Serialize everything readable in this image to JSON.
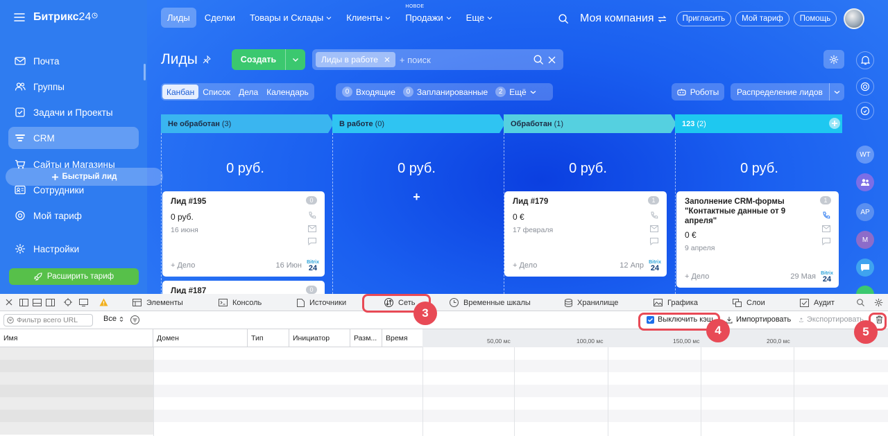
{
  "brand": {
    "name_bold": "Битрикс",
    "name_num": "24",
    "accent": "#2f7cf0"
  },
  "sidebar": {
    "items": [
      {
        "label": "Почта",
        "icon": "mail-icon"
      },
      {
        "label": "Группы",
        "icon": "groups-icon"
      },
      {
        "label": "Задачи и Проекты",
        "icon": "tasks-icon"
      },
      {
        "label": "CRM",
        "icon": "crm-icon",
        "active": true
      },
      {
        "label": "Сайты и Магазины",
        "icon": "cart-icon"
      },
      {
        "label": "Сотрудники",
        "icon": "employees-icon"
      },
      {
        "label": "Мой тариф",
        "icon": "tariff-icon"
      },
      {
        "label": "Настройки",
        "icon": "settings-icon"
      }
    ],
    "upgrade_button": "Расширить тариф",
    "upgrade_color": "#57c04a"
  },
  "topnav": {
    "items": [
      {
        "label": "Лиды",
        "active": true
      },
      {
        "label": "Сделки"
      },
      {
        "label": "Товары и Склады"
      },
      {
        "label": "Клиенты"
      },
      {
        "label": "Продажи",
        "badge": "НОВОЕ"
      },
      {
        "label": "Еще"
      }
    ],
    "company": "Моя компания",
    "invite": "Пригласить",
    "tariff": "Мой тариф",
    "help": "Помощь"
  },
  "page": {
    "title": "Лиды",
    "create": "Создать"
  },
  "search": {
    "chip": "Лиды в работе",
    "placeholder": "+ поиск"
  },
  "views": [
    "Канбан",
    "Список",
    "Дела",
    "Календарь"
  ],
  "counters": [
    {
      "n": "0",
      "label": "Входящие"
    },
    {
      "n": "0",
      "label": "Запланированные"
    },
    {
      "n": "2",
      "label": "Ещё"
    }
  ],
  "robots": "Роботы",
  "distribution": "Распределение лидов",
  "right_rail": {
    "initials": [
      "WT",
      "AP",
      "M"
    ]
  },
  "kanban": {
    "quick_lead": "Быстрый лид",
    "add_deal": "+ Дело",
    "columns": [
      {
        "name": "Не обработан",
        "count": "(3)",
        "sum": "0 руб.",
        "color": "#3ab5f0"
      },
      {
        "name": "В работе",
        "count": "(0)",
        "sum": "0 руб.",
        "color": "#2fc4f2"
      },
      {
        "name": "Обработан",
        "count": "(1)",
        "sum": "0 руб.",
        "color": "#55d0e0"
      },
      {
        "name": "123",
        "count": "(2)",
        "sum": "0 руб.",
        "color": "#1ec8f0"
      }
    ],
    "cards": [
      {
        "title": "Лид #195",
        "price": "0 руб.",
        "date": "16 июня",
        "badge": "0",
        "cdate": "16 Июн"
      },
      {
        "title": "Лид #187",
        "badge": "0"
      },
      {
        "title": "Лид #179",
        "price": "0 €",
        "date": "17 февраля",
        "badge": "1",
        "cdate": "12 Апр"
      },
      {
        "title": "Заполнение CRM-формы \"Контактные данные от 9 апреля\"",
        "price": "0 €",
        "date": "9 апреля",
        "badge": "1",
        "cdate": "29 Мая"
      }
    ],
    "b24_small": "Bitrix",
    "b24_big": "24"
  },
  "devtools": {
    "tabs": [
      "Элементы",
      "Консоль",
      "Источники",
      "Сеть",
      "Временные шкалы",
      "Хранилище",
      "Графика",
      "Слои",
      "Аудит"
    ],
    "filter_placeholder": "Фильтр всего URL",
    "type_select": "Все",
    "disable_cache": "Выключить кэш",
    "import": "Импортировать",
    "export": "Экспортировать",
    "columns": [
      "Имя",
      "Домен",
      "Тип",
      "Инициатор",
      "Разм...",
      "Время"
    ],
    "timeline": [
      "50,00 мс",
      "100,00 мс",
      "150,00 мс",
      "200,0 мс"
    ]
  },
  "callouts": [
    "3",
    "4",
    "5"
  ]
}
